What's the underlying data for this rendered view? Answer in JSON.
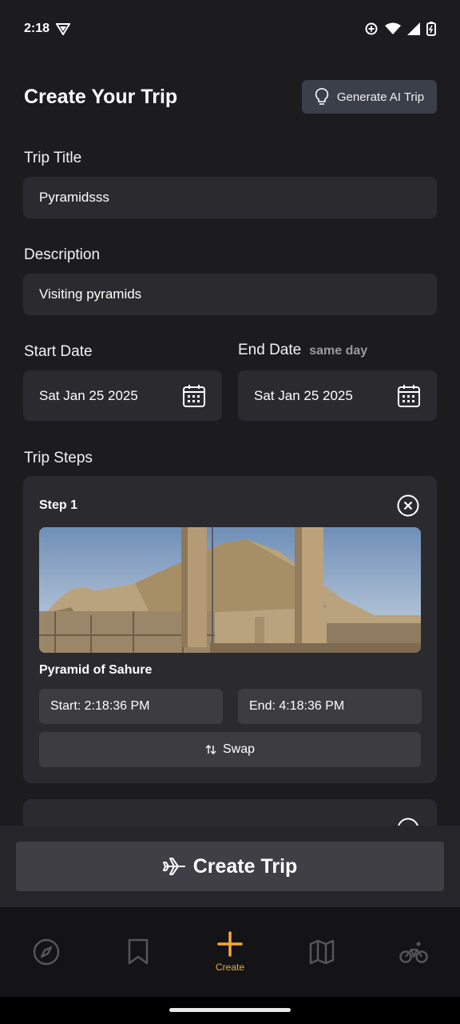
{
  "status_bar": {
    "time": "2:18"
  },
  "header": {
    "title": "Create Your Trip",
    "ai_button_label": "Generate AI Trip"
  },
  "form": {
    "trip_title_label": "Trip Title",
    "trip_title_value": "Pyramidsss",
    "description_label": "Description",
    "description_value": "Visiting pyramids",
    "start_date_label": "Start Date",
    "start_date_value": "Sat Jan 25 2025",
    "end_date_label": "End Date",
    "end_date_note": "same day",
    "end_date_value": "Sat Jan 25 2025"
  },
  "steps": {
    "section_label": "Trip Steps",
    "items": [
      {
        "title": "Step 1",
        "place": "Pyramid of Sahure",
        "start": "Start: 2:18:36 PM",
        "end": "End: 4:18:36 PM",
        "swap_label": "Swap"
      }
    ]
  },
  "create_button": {
    "label": "Create Trip"
  },
  "bottom_nav": {
    "items": [
      {
        "icon": "compass-icon",
        "label": ""
      },
      {
        "icon": "bookmark-icon",
        "label": ""
      },
      {
        "icon": "plus-icon",
        "label": "Create",
        "active": true
      },
      {
        "icon": "map-icon",
        "label": ""
      },
      {
        "icon": "bike-icon",
        "label": ""
      }
    ]
  },
  "colors": {
    "background": "#1c1c1f",
    "card": "#2b2b2f",
    "accent": "#f0a93a"
  }
}
